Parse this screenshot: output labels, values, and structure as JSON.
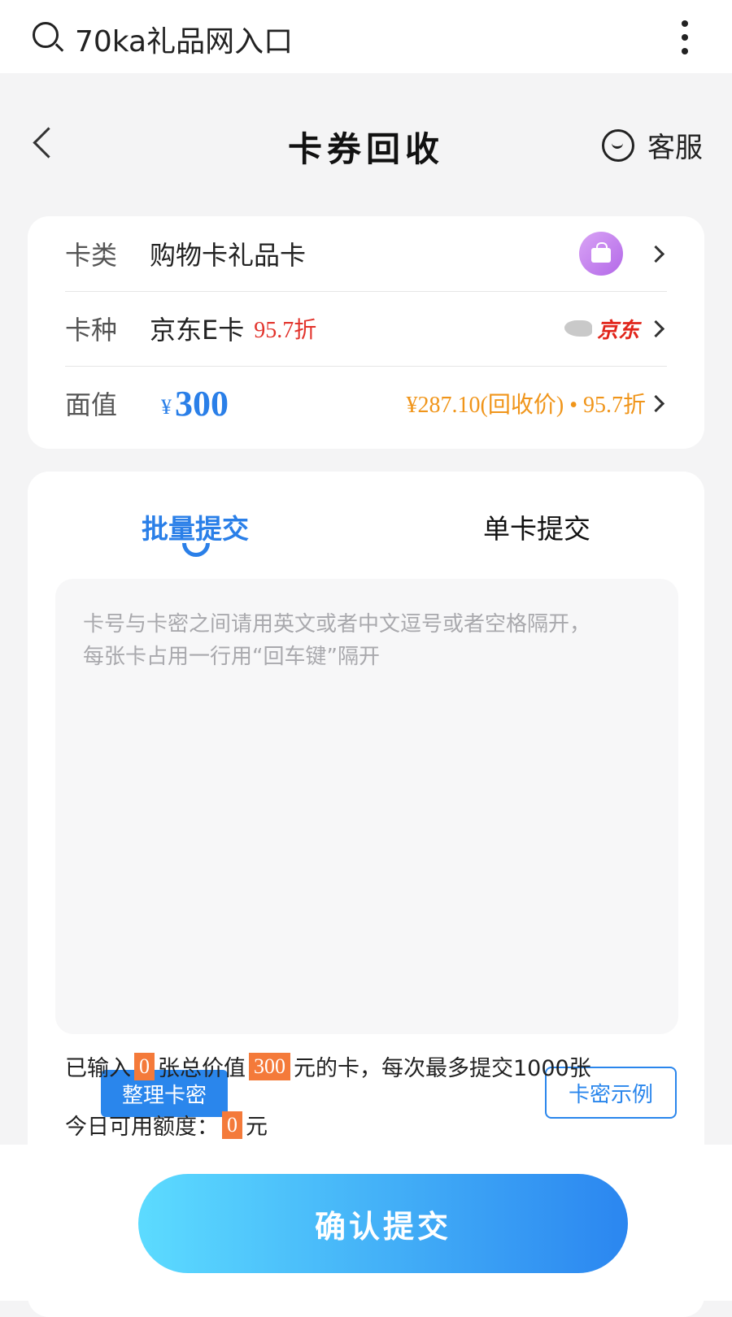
{
  "browser": {
    "search_text": "70ka礼品网入口"
  },
  "header": {
    "title": "卡券回收",
    "customer_service": "客服"
  },
  "info": {
    "card_type_label": "卡类",
    "card_type_value": "购物卡礼品卡",
    "card_kind_label": "卡种",
    "card_kind_value": "京东E卡",
    "card_kind_discount": "95.7折",
    "brand_logo_text": "京东",
    "face_label": "面值",
    "face_currency": "¥",
    "face_value": "300",
    "recycle_price": "¥287.10(回收价) • 95.7折"
  },
  "tabs": {
    "batch": "批量提交",
    "single": "单卡提交"
  },
  "input": {
    "placeholder_line1": "卡号与卡密之间请用英文或者中文逗号或者空格隔开，",
    "placeholder_line2": "每张卡占用一行用“回车键”隔开",
    "tidy_button": "整理卡密",
    "example_button": "卡密示例"
  },
  "summary": {
    "prefix": "已输入",
    "count": "0",
    "mid": "张总价值",
    "total": "300",
    "suffix": "元的卡，每次最多提交1000张"
  },
  "quota": {
    "label": "今日可用额度：",
    "value": "0",
    "unit": "元"
  },
  "footer": {
    "confirm": "确认提交"
  }
}
